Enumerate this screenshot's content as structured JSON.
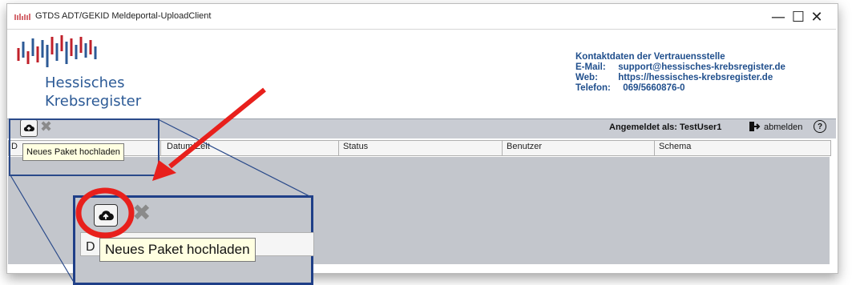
{
  "window": {
    "title": "GTDS ADT/GEKID Meldeportal-UploadClient",
    "controls": {
      "minimize": "—",
      "maximize": "☐",
      "close": "✕"
    }
  },
  "header": {
    "logo_line1": "Hessisches",
    "logo_line2": "Krebsregister",
    "contact": {
      "heading": "Kontaktdaten der Vertrauensstelle",
      "email_label": "E-Mail:",
      "email_value": "support@hessisches-krebsregister.de",
      "web_label": "Web:",
      "web_value": "https://hessisches-krebsregister.de",
      "phone_label": "Telefon:",
      "phone_value": "069/5660876-0"
    }
  },
  "toolbar": {
    "upload_icon": "cloud-upload-icon",
    "delete_icon": "delete-x-icon",
    "logged_in": "Angemeldet als: TestUser1",
    "logout_label": "abmelden",
    "help_icon": "help-icon",
    "help_glyph": "?"
  },
  "table": {
    "columns": [
      "D",
      "Datum/Zeit",
      "Status",
      "Benutzer",
      "Schema"
    ]
  },
  "tooltip": {
    "text": "Neues Paket hochladen"
  },
  "zoom": {
    "column_initial": "D",
    "tooltip": "Neues Paket hochladen"
  },
  "colors": {
    "brand_blue": "#2c5a96",
    "logo_red": "#c0202a",
    "arrow_red": "#e8201c",
    "highlight_blue": "#1f3f88",
    "toolbar_bg": "#c9ccd3"
  }
}
